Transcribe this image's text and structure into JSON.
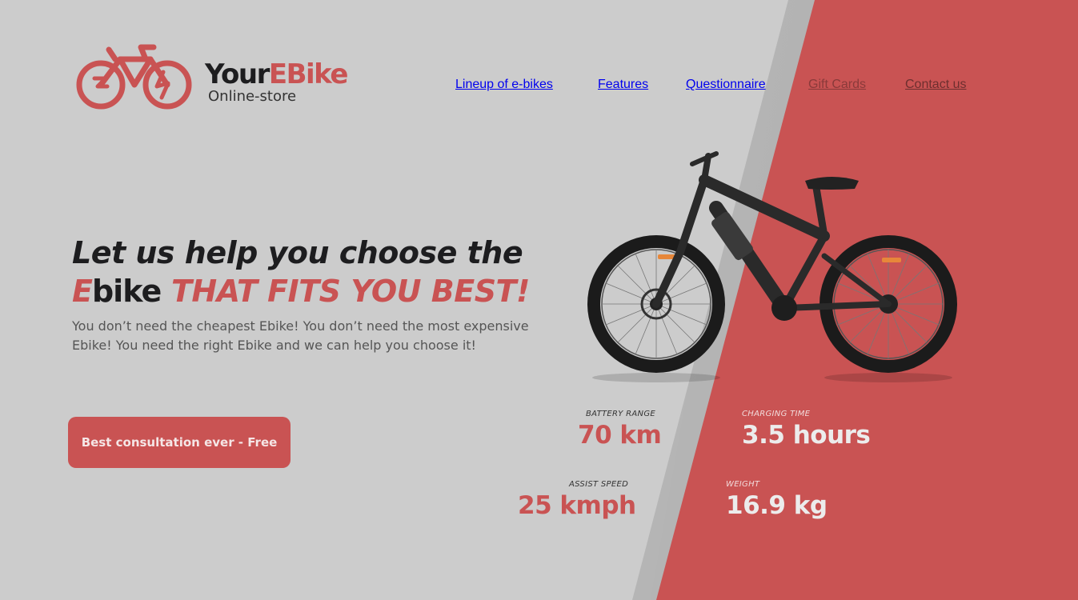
{
  "brand": {
    "name_part1": "Your",
    "name_part2": "EBike",
    "subtitle": "Online-store",
    "accent_color": "#c95353",
    "logo_icon": "electric-bike-icon"
  },
  "nav": {
    "items": [
      {
        "label": "Lineup of e-bikes"
      },
      {
        "label": "Features"
      },
      {
        "label": "Questionnaire"
      },
      {
        "label": "Gift Cards"
      },
      {
        "label": "Contact us"
      }
    ]
  },
  "hero": {
    "heading_line1": "Let us help you choose the",
    "heading_e": "E",
    "heading_bike": "bike",
    "heading_highlight": "THAT FITS YOU BEST!",
    "description": "You don’t need the cheapest Ebike! You don’t need the most expensive Ebike! You need the right Ebike and we can help you choose it!",
    "cta_label": "Best consultation ever - Free"
  },
  "stats": [
    {
      "label": "BATTERY RANGE",
      "value": "70 km"
    },
    {
      "label": "CHARGING TIME",
      "value": "3.5 hours"
    },
    {
      "label": "ASSIST SPEED",
      "value": "25 kmph"
    },
    {
      "label": "WEIGHT",
      "value": "16.9 kg"
    }
  ],
  "colors": {
    "background": "#cccccc",
    "accent": "#c95353",
    "text_dark": "#1d1d1f"
  }
}
